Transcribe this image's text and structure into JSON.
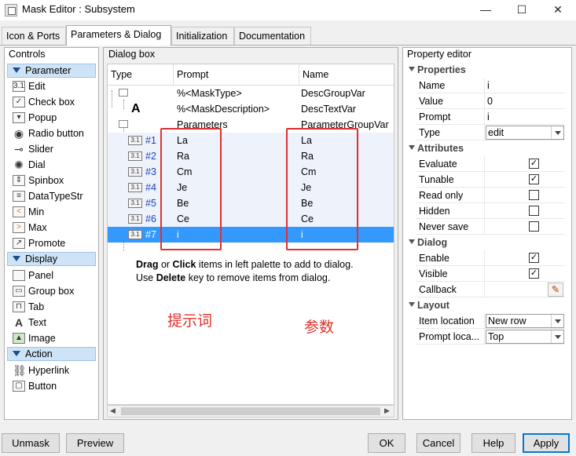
{
  "window": {
    "title": "Mask Editor : Subsystem",
    "minimize": "—",
    "maximize": "☐",
    "close": "✕"
  },
  "tabs": [
    {
      "label": "Icon & Ports"
    },
    {
      "label": "Parameters & Dialog"
    },
    {
      "label": "Initialization"
    },
    {
      "label": "Documentation"
    }
  ],
  "controls": {
    "title": "Controls",
    "categories": {
      "parameter": "Parameter",
      "display": "Display",
      "action": "Action"
    },
    "parameter_items": [
      "Edit",
      "Check box",
      "Popup",
      "Radio button",
      "Slider",
      "Dial",
      "Spinbox",
      "DataTypeStr",
      "Min",
      "Max",
      "Promote"
    ],
    "display_items": [
      "Panel",
      "Group box",
      "Tab",
      "Text",
      "Image"
    ],
    "action_items": [
      "Hyperlink",
      "Button"
    ]
  },
  "dialog_box": {
    "title": "Dialog box",
    "headers": {
      "type": "Type",
      "prompt": "Prompt",
      "name": "Name"
    },
    "rows": [
      {
        "num": "",
        "prompt": "%<MaskType>",
        "name": "DescGroupVar"
      },
      {
        "num": "",
        "icon": "A",
        "prompt": "%<MaskDescription>",
        "name": "DescTextVar"
      },
      {
        "num": "",
        "prompt": "Parameters",
        "name": "ParameterGroupVar"
      },
      {
        "num": "#1",
        "prompt": "La",
        "name": "La"
      },
      {
        "num": "#2",
        "prompt": "Ra",
        "name": "Ra"
      },
      {
        "num": "#3",
        "prompt": "Cm",
        "name": "Cm"
      },
      {
        "num": "#4",
        "prompt": "Je",
        "name": "Je"
      },
      {
        "num": "#5",
        "prompt": "Be",
        "name": "Be"
      },
      {
        "num": "#6",
        "prompt": "Ce",
        "name": "Ce"
      },
      {
        "num": "#7",
        "prompt": "i",
        "name": "i"
      }
    ],
    "edit_icon_label": "3.1",
    "hint": {
      "drag": "Drag",
      "or": " or ",
      "click": "Click",
      "line1_rest": " items in left palette to add to dialog.",
      "use": "Use ",
      "delete": "Delete",
      "line2_rest": " key to remove items from dialog."
    },
    "annotation_prompt": "提示词",
    "annotation_param": "参数"
  },
  "property_editor": {
    "title": "Property editor",
    "sections": {
      "properties": "Properties",
      "attributes": "Attributes",
      "dialog": "Dialog",
      "layout": "Layout"
    },
    "properties": {
      "name_label": "Name",
      "name_value": "i",
      "value_label": "Value",
      "value_value": "0",
      "prompt_label": "Prompt",
      "prompt_value": "i",
      "type_label": "Type",
      "type_value": "edit"
    },
    "attributes": {
      "evaluate": "Evaluate",
      "evaluate_checked": true,
      "tunable": "Tunable",
      "tunable_checked": true,
      "read_only": "Read only",
      "read_only_checked": false,
      "hidden": "Hidden",
      "hidden_checked": false,
      "never_save": "Never save",
      "never_save_checked": false
    },
    "dialog": {
      "enable": "Enable",
      "enable_checked": true,
      "visible": "Visible",
      "visible_checked": true,
      "callback": "Callback"
    },
    "layout": {
      "item_location_label": "Item location",
      "item_location_value": "New row",
      "prompt_location_label": "Prompt loca...",
      "prompt_location_value": "Top"
    }
  },
  "buttons": {
    "unmask": "Unmask",
    "preview": "Preview",
    "ok": "OK",
    "cancel": "Cancel",
    "help": "Help",
    "apply": "Apply"
  },
  "colors": {
    "selection": "#3399ff",
    "annotation": "#e0302a",
    "category_bg": "#cfe3f7"
  }
}
